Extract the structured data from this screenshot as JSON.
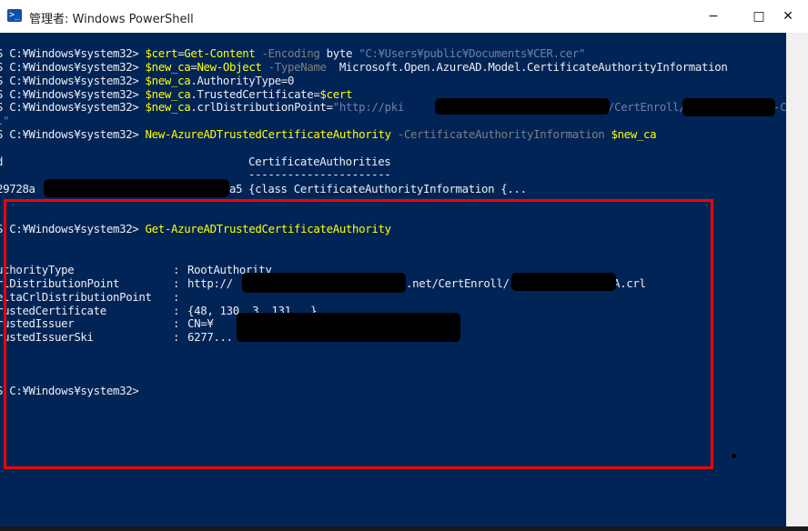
{
  "window": {
    "icon": "powershell-icon",
    "title": "管理者: Windows PowerShell",
    "controls": {
      "minimize": "−",
      "maximize": "□",
      "close": "✕"
    }
  },
  "colors": {
    "console_bg": "#012456",
    "text": "#eeedf0",
    "command": "#ffff00",
    "parameter": "#7f7f7f",
    "string": "#6f7fa8",
    "highlight_border": "#ff0000"
  },
  "console": {
    "prompt": "S C:¥Windows¥system32> ",
    "cmd1": {
      "var": "$cert",
      "eq": "=",
      "command": "Get-Content",
      "p1": " -Encoding",
      "v1": " byte ",
      "str": "\"C:¥Users¥public¥Documents¥CER.cer\""
    },
    "cmd2": {
      "var": "$new_ca",
      "eq": "=",
      "command": "New-Object",
      "p1": " -TypeName",
      "v1": "  Microsoft.Open.AzureAD.Model.CertificateAuthorityInformation"
    },
    "cmd3": {
      "var": "$new_ca",
      "prop": ".AuthorityType=0"
    },
    "cmd4": {
      "var": "$new_ca",
      "prop": ".TrustedCertificate=",
      "var2": "$cert"
    },
    "cmd5": {
      "var": "$new_ca",
      "prop": ".crlDistributionPoint=",
      "s1": "\"http://pki",
      "s2": "/CertEnroll/",
      "s3": "-CA.c"
    },
    "cmd5_wrap": "l\"",
    "cmd6": {
      "command": "New-AzureADTrustedCertificateAuthority",
      "p1": " -CertificateAuthorityInformation",
      "var": " $new_ca"
    },
    "table_header": {
      "col1": "d",
      "col2": "CertificateAuthorities"
    },
    "table_sep": "----------------------",
    "table_row": {
      "id_start": "29728a",
      "id_end": "a5",
      "value": "{class CertificateAuthorityInformation {..."
    },
    "cmd7": {
      "command": "Get-AzureADTrustedCertificateAuthority"
    },
    "properties": [
      {
        "name": "uthorityType",
        "value": "RootAuthority"
      },
      {
        "name": "rlDistributionPoint",
        "value": "http://",
        "value_mid": ".net/CertEnroll/",
        "value_end": "A.crl"
      },
      {
        "name": "eltaCrlDistributionPoint",
        "value": ""
      },
      {
        "name": "rustedCertificate",
        "value": "{48, 130, 3, 131...}"
      },
      {
        "name": "rustedIssuer",
        "value": "CN=¥"
      },
      {
        "name": "rustedIssuerSki",
        "value": "6277..."
      }
    ],
    "separator": ": "
  }
}
